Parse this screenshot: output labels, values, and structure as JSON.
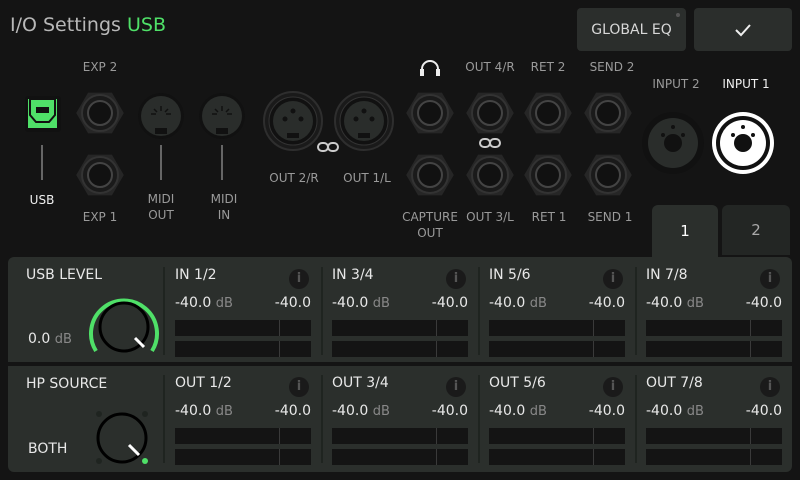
{
  "header": {
    "title": "I/O Settings",
    "title_accent": "USB",
    "global_eq_label": "GLOBAL EQ",
    "confirm_icon": "check-icon",
    "accent": "#4fe068"
  },
  "ports": {
    "exp2": "EXP 2",
    "exp1": "EXP 1",
    "usb": "USB",
    "midi_out": [
      "MIDI",
      "OUT"
    ],
    "midi_in": [
      "MIDI",
      "IN"
    ],
    "out2r": "OUT 2/R",
    "out1l": "OUT 1/L",
    "out4r": "OUT 4/R",
    "ret2": "RET 2",
    "send2": "SEND 2",
    "capture_out": [
      "CAPTURE",
      "OUT"
    ],
    "out3l": "OUT 3/L",
    "ret1": "RET 1",
    "send1": "SEND 1",
    "input2": "INPUT 2",
    "input1": "INPUT 1"
  },
  "tabs": [
    {
      "label": "1",
      "active": true
    },
    {
      "label": "2",
      "active": false
    }
  ],
  "usb_level": {
    "label": "USB LEVEL",
    "value": "0.0",
    "unit": "dB"
  },
  "hp_source": {
    "label": "HP SOURCE",
    "value": "BOTH"
  },
  "inputs": [
    {
      "name": "IN 1/2",
      "left": "-40.0",
      "unit": "dB",
      "right": "-40.0"
    },
    {
      "name": "IN 3/4",
      "left": "-40.0",
      "unit": "dB",
      "right": "-40.0"
    },
    {
      "name": "IN 5/6",
      "left": "-40.0",
      "unit": "dB",
      "right": "-40.0"
    },
    {
      "name": "IN 7/8",
      "left": "-40.0",
      "unit": "dB",
      "right": "-40.0"
    }
  ],
  "outputs": [
    {
      "name": "OUT 1/2",
      "left": "-40.0",
      "unit": "dB",
      "right": "-40.0"
    },
    {
      "name": "OUT 3/4",
      "left": "-40.0",
      "unit": "dB",
      "right": "-40.0"
    },
    {
      "name": "OUT 5/6",
      "left": "-40.0",
      "unit": "dB",
      "right": "-40.0"
    },
    {
      "name": "OUT 7/8",
      "left": "-40.0",
      "unit": "dB",
      "right": "-40.0"
    }
  ],
  "info_glyph": "i"
}
